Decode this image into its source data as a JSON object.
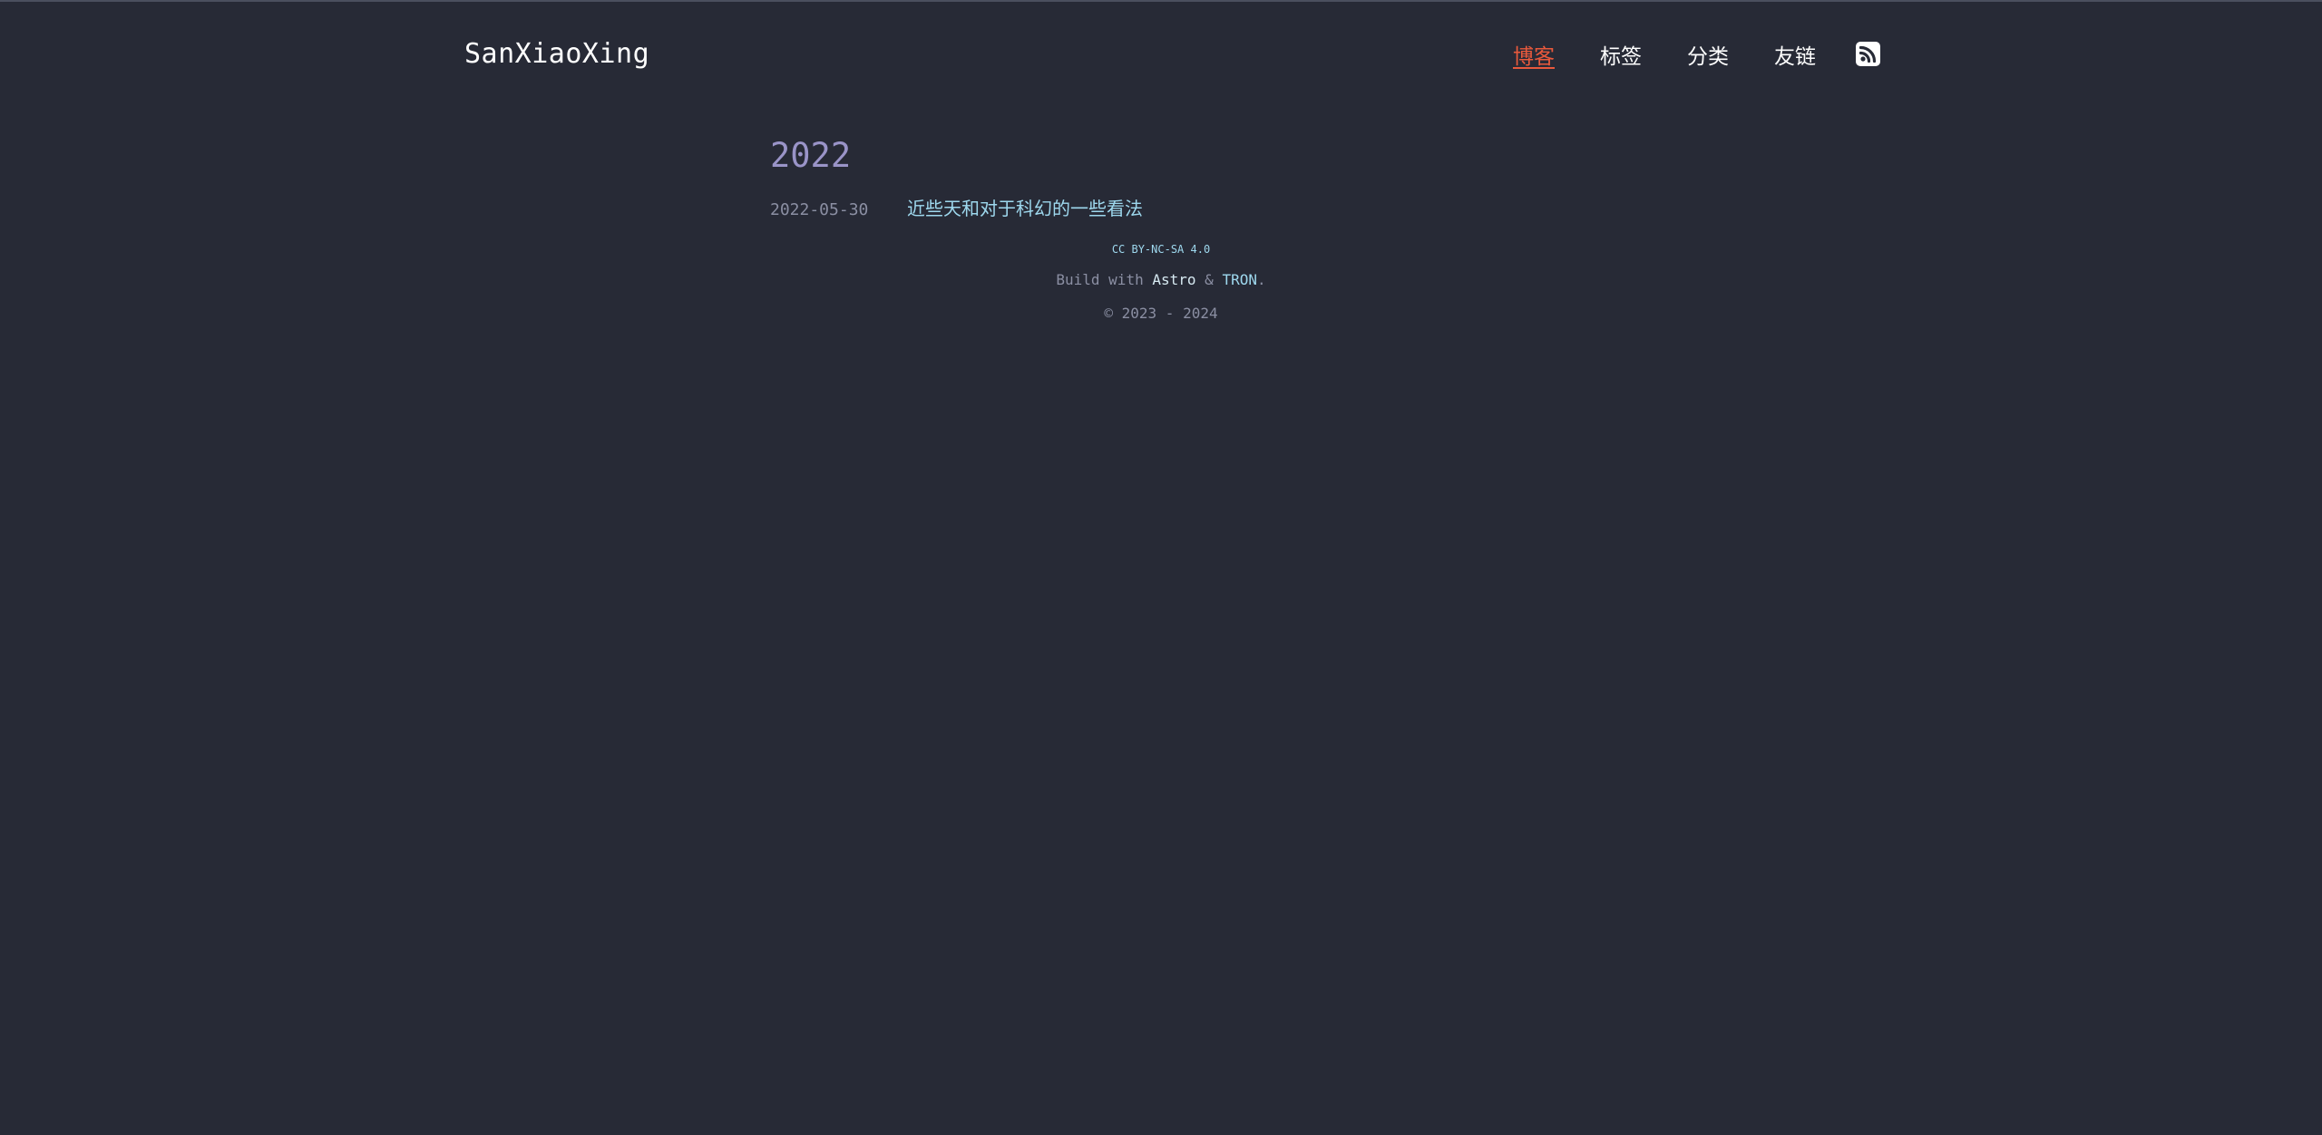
{
  "header": {
    "site_title": "SanXiaoXing",
    "nav": [
      {
        "label": "博客",
        "active": true
      },
      {
        "label": "标签",
        "active": false
      },
      {
        "label": "分类",
        "active": false
      },
      {
        "label": "友链",
        "active": false
      }
    ],
    "rss_icon": "rss-icon"
  },
  "main": {
    "year": "2022",
    "posts": [
      {
        "date": "2022-05-30",
        "title": "近些天和对于科幻的一些看法"
      }
    ]
  },
  "footer": {
    "license": "CC BY-NC-SA 4.0",
    "build_prefix": "Build with",
    "astro": "Astro",
    "amp": "&",
    "tron": "TRON",
    "period": ".",
    "copyright": "© 2023 - 2024"
  },
  "colors": {
    "background": "#272a36",
    "accent": "#e8593c",
    "link": "#9ed8ee",
    "year": "#9a94c8",
    "muted": "#8b8fa3"
  }
}
